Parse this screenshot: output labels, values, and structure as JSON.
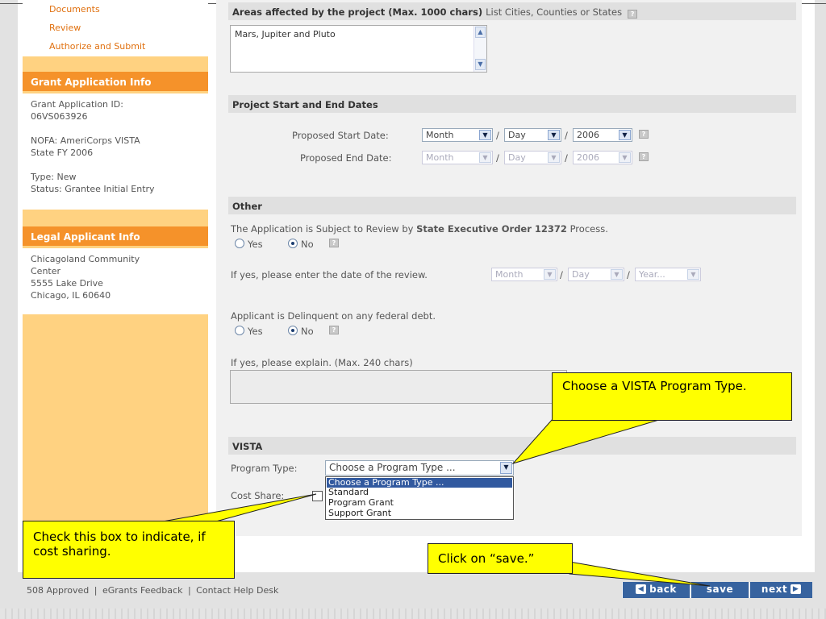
{
  "sidebar": {
    "links": [
      "Documents",
      "Review",
      "Authorize and Submit"
    ],
    "grant_info": {
      "heading": "Grant Application Info",
      "id_label": "Grant Application ID:",
      "id_value": "06VS063926",
      "nofa_line1": "NOFA: AmeriCorps VISTA",
      "nofa_line2": "State FY 2006",
      "type": "Type: New",
      "status": "Status: Grantee Initial Entry"
    },
    "legal_info": {
      "heading": "Legal Applicant Info",
      "line1": "Chicagoland Community",
      "line2": "Center",
      "line3": "5555 Lake Drive",
      "line4": "Chicago, IL 60640"
    }
  },
  "areas": {
    "heading": "Areas affected by the project (Max. 1000 chars)",
    "hint": "List Cities, Counties or States",
    "value": "Mars, Jupiter and Pluto"
  },
  "dates": {
    "heading": "Project Start and End Dates",
    "start_label": "Proposed Start Date:",
    "end_label": "Proposed End Date:",
    "month": "Month",
    "day": "Day",
    "year": "2006",
    "separator": "/"
  },
  "other": {
    "heading": "Other",
    "review_text_pre": "The Application is Subject to Review by ",
    "review_text_bold": "State Executive Order 12372",
    "review_text_post": " Process.",
    "yes": "Yes",
    "no": "No",
    "review_date_label": "If yes, please enter the date of the review.",
    "month": "Month",
    "day": "Day",
    "year": "Year...",
    "delinquent_text": "Applicant is Delinquent on any federal debt.",
    "explain_label": "If yes, please explain. (Max. 240 chars)"
  },
  "vista": {
    "heading": "VISTA",
    "program_type_label": "Program Type:",
    "program_type_value": "Choose a Program Type ...",
    "cost_share_label": "Cost Share:",
    "options": [
      "Choose a Program Type ...",
      "Standard",
      "Program Grant",
      "Support Grant"
    ]
  },
  "callouts": {
    "vista": "Choose a VISTA Program Type.",
    "checkbox": "Check this box to indicate, if cost sharing.",
    "save": "Click on “save.”"
  },
  "footer": {
    "links": [
      "508 Approved",
      "eGrants Feedback",
      "Contact Help Desk"
    ],
    "divider": "|",
    "back": "back",
    "save": "save",
    "next": "next"
  },
  "icons": {
    "help": "help-icon",
    "arrow": "chevron-down-icon"
  },
  "colors": {
    "accent_orange": "#f5922a",
    "sidebar_bg": "#ffd281",
    "nav_blue": "#37639f",
    "callout_yellow": "#ffff00"
  }
}
